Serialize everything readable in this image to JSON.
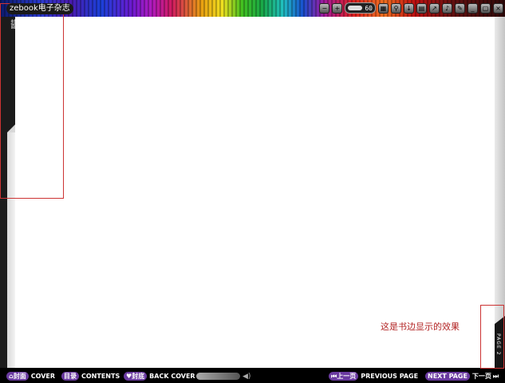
{
  "header": {
    "title": "zebook电子杂志",
    "zoom_value": "60",
    "tool_icons": [
      "zoom-out-icon",
      "zoom-in-icon",
      "thumbnails-icon",
      "search-icon",
      "download-icon",
      "print-icon",
      "share-icon",
      "sound-icon",
      "edit-icon",
      "minimize-icon",
      "restore-icon",
      "close-icon"
    ]
  },
  "left_spine": {
    "label": "封面"
  },
  "right_spine": {
    "label": "PAGE 2"
  },
  "annotation": {
    "text": "这是书边显示的效果"
  },
  "footer": {
    "cover_cn": "封面",
    "cover_en": "COVER",
    "contents_cn": "目录",
    "contents_en": "CONTENTS",
    "back_cover_cn": "封底",
    "back_cover_en": "BACK COVER",
    "prev_cn": "上一页",
    "prev_en": "PREVIOUS PAGE",
    "next_en": "NEXT PAGE",
    "next_cn": "下一页"
  },
  "colors": {
    "annotation": "#b22222",
    "pill_purple": "#6a3aa0",
    "pill_gold": "#b08a2a"
  }
}
